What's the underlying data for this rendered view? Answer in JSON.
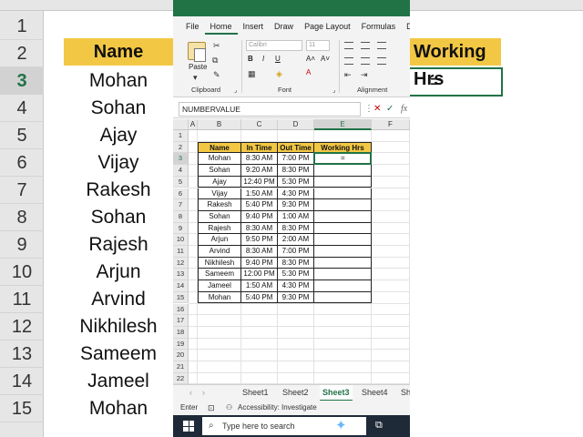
{
  "background": {
    "row_numbers": [
      "1",
      "2",
      "3",
      "4",
      "5",
      "6",
      "7",
      "8",
      "9",
      "10",
      "11",
      "12",
      "13",
      "14",
      "15"
    ],
    "header_name": "Name",
    "header_working": "Working Hrs",
    "names": [
      "Mohan",
      "Sohan",
      "Ajay",
      "Vijay",
      "Rakesh",
      "Sohan",
      "Rajesh",
      "Arjun",
      "Arvind",
      "Nikhilesh",
      "Sameem",
      "Jameel",
      "Mohan"
    ],
    "formula_text": "="
  },
  "ribbon": {
    "tabs": [
      "File",
      "Home",
      "Insert",
      "Draw",
      "Page Layout",
      "Formulas",
      "Da"
    ],
    "active_tab": "Home",
    "paste_label": "Paste",
    "clipboard_label": "Clipboard",
    "font_label": "Font",
    "alignment_label": "Alignment",
    "font_name": "Calibri",
    "font_size": "11"
  },
  "formula_bar": {
    "name_box": "NUMBERVALUE",
    "fx": "fx"
  },
  "columns": [
    "A",
    "B",
    "C",
    "D",
    "E",
    "F"
  ],
  "rows": [
    "1",
    "2",
    "3",
    "4",
    "5",
    "6",
    "7",
    "8",
    "9",
    "10",
    "11",
    "12",
    "13",
    "14",
    "15",
    "16",
    "17",
    "18",
    "19",
    "20",
    "21",
    "22"
  ],
  "table": {
    "headers": [
      "Name",
      "In Time",
      "Out Time",
      "Working Hrs"
    ],
    "rows": [
      [
        "Mohan",
        "8:30 AM",
        "7:00 PM"
      ],
      [
        "Sohan",
        "9:20 AM",
        "8:30 PM"
      ],
      [
        "Ajay",
        "12:40 PM",
        "5:30 PM"
      ],
      [
        "Vijay",
        "1:50 AM",
        "4:30 PM"
      ],
      [
        "Rakesh",
        "5:40 PM",
        "9:30 PM"
      ],
      [
        "Sohan",
        "9:40 PM",
        "1:00 AM"
      ],
      [
        "Rajesh",
        "8:30 AM",
        "8:30 PM"
      ],
      [
        "Arjun",
        "9:50 PM",
        "2:00 AM"
      ],
      [
        "Arvind",
        "8:30 AM",
        "7:00 PM"
      ],
      [
        "Nikhilesh",
        "9:40 PM",
        "8:30 PM"
      ],
      [
        "Sameem",
        "12:00 PM",
        "5:30 PM"
      ],
      [
        "Jameel",
        "1:50 AM",
        "4:30 PM"
      ],
      [
        "Mohan",
        "5:40 PM",
        "9:30 PM"
      ]
    ],
    "active_cell_text": "="
  },
  "sheets": [
    "Sheet1",
    "Sheet2",
    "Sheet3",
    "Sheet4",
    "Sh"
  ],
  "active_sheet": "Sheet3",
  "status": {
    "mode": "Enter",
    "accessibility": "Accessibility: Investigate"
  },
  "taskbar": {
    "search_placeholder": "Type here to search"
  },
  "colors": {
    "accent": "#217346",
    "header_fill": "#f2c744"
  }
}
